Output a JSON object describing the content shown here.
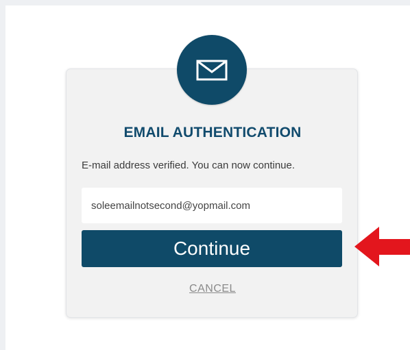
{
  "auth": {
    "title": "EMAIL AUTHENTICATION",
    "message": "E-mail address verified. You can now continue.",
    "email_value": "soleemailnotsecond@yopmail.com",
    "email_placeholder": "",
    "continue_label": "Continue",
    "cancel_label": "CANCEL"
  },
  "icons": {
    "badge": "mail-icon",
    "annotation": "red-left-arrow"
  },
  "colors": {
    "primary": "#0f4a68",
    "title": "#114b6d",
    "annotation": "#e3161d"
  }
}
